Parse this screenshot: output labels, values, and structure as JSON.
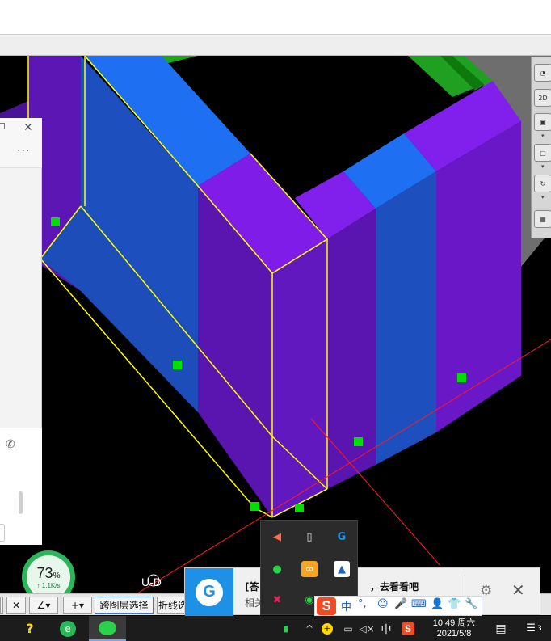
{
  "viewport": {
    "axis_label": "U-D"
  },
  "chat_panel": {
    "more_label": "···",
    "phone_icon": "phone-icon"
  },
  "network_widget": {
    "percent": "73",
    "percent_sign": "%",
    "rate": "↑ 1.1K/s"
  },
  "status_bar": {
    "cross_layer_select": "跨图层选择",
    "polyline_select": "折线选"
  },
  "notification": {
    "title_prefix": "[答",
    "title_suffix": "，去看看吧",
    "subtitle": "相关"
  },
  "ime": {
    "logo": "S",
    "mode": "中",
    "punct": "°,",
    "emoji": "☺",
    "mic": "🎤",
    "keyboard": "⌨",
    "user": "👤",
    "shirt": "👕",
    "tools": "🔧"
  },
  "taskbar": {
    "ime_indicator": "中",
    "clock_time": "10:49 周六",
    "clock_date": "2021/5/8",
    "notification_count": "3",
    "wechat_icon": "wechat-icon"
  },
  "colors": {
    "beam_blue": "#1f6ff2",
    "beam_purple": "#7f1ce8",
    "wall_blue": "#1e4fbf",
    "wall_purple": "#5a14b0",
    "edge_yellow": "#ffff00",
    "grip_green": "#00e000",
    "axis_red": "#ff1a1a"
  }
}
